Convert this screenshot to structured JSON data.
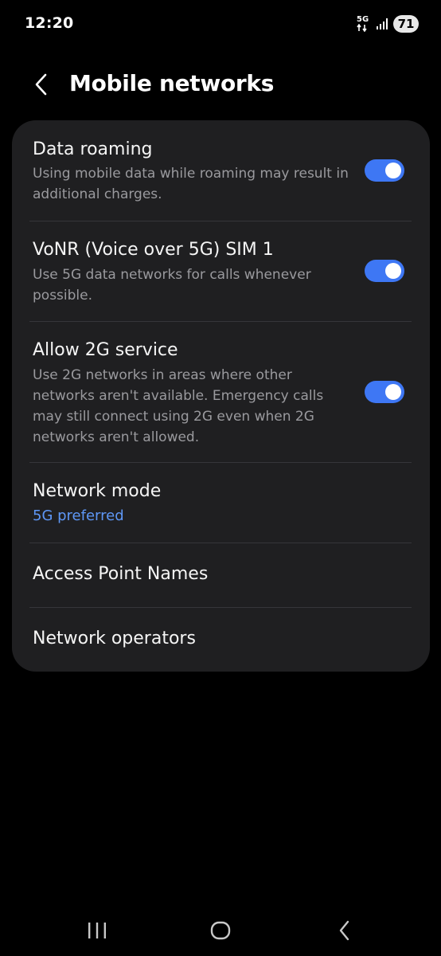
{
  "status_bar": {
    "time": "12:20",
    "network": "5G",
    "battery": "71"
  },
  "header": {
    "title": "Mobile networks"
  },
  "settings": {
    "data_roaming": {
      "title": "Data roaming",
      "description": "Using mobile data while roaming may result in additional charges.",
      "enabled": true
    },
    "vonr": {
      "title": "VoNR (Voice over 5G) SIM 1",
      "description": "Use 5G data networks for calls whenever possible.",
      "enabled": true
    },
    "allow_2g": {
      "title": "Allow 2G service",
      "description": "Use 2G networks in areas where other networks aren't available. Emergency calls may still connect using 2G even when 2G networks aren't allowed.",
      "enabled": true
    },
    "network_mode": {
      "title": "Network mode",
      "value": "5G preferred"
    },
    "apn": {
      "title": "Access Point Names"
    },
    "operators": {
      "title": "Network operators"
    }
  },
  "colors": {
    "background": "#000000",
    "card": "#1f1f21",
    "accent": "#3e77f4",
    "link": "#5e97f6",
    "secondary_text": "#9a9a9e"
  },
  "nav_icons": [
    "recent-apps-icon",
    "home-icon",
    "back-icon"
  ]
}
